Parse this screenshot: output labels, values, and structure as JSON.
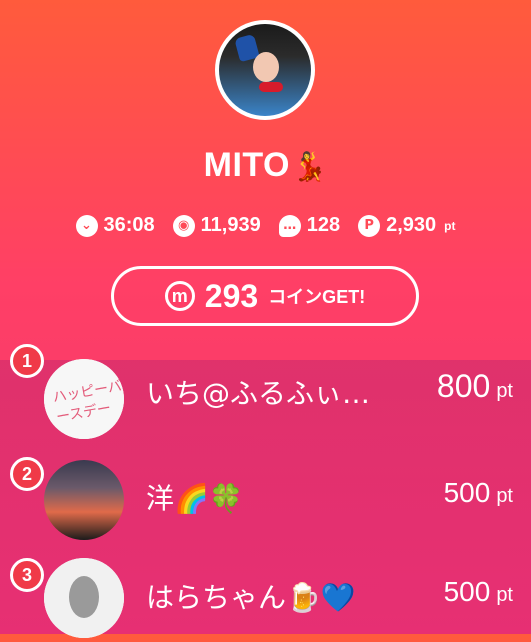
{
  "profile": {
    "name": "MITO",
    "name_emoji": "💃",
    "stats": {
      "time": "36:08",
      "views": "11,939",
      "comments": "128",
      "points": "2,930",
      "points_suffix": "pt"
    },
    "coin_button": {
      "count": "293",
      "suffix": "コインGET!"
    }
  },
  "ranking": [
    {
      "rank": "1",
      "name": "いち@ふるふぃ…",
      "points": "800",
      "pt_suffix": "pt",
      "avatar_text": "ハッピーバースデー"
    },
    {
      "rank": "2",
      "name": "洋🌈🍀",
      "points": "500",
      "pt_suffix": "pt"
    },
    {
      "rank": "3",
      "name": "はらちゃん🍺💙",
      "points": "500",
      "pt_suffix": "pt"
    }
  ],
  "icons": {
    "time_icon": "chevron-down-icon",
    "views_icon": "signal-icon",
    "comments_icon": "chat-bubble-icon",
    "points_icon": "p-badge-icon",
    "coin_icon": "m-coin-icon"
  },
  "colors": {
    "gradient_top": "#ff5b3c",
    "gradient_bottom": "#f0356f",
    "rank_badge": "#f03a48"
  }
}
